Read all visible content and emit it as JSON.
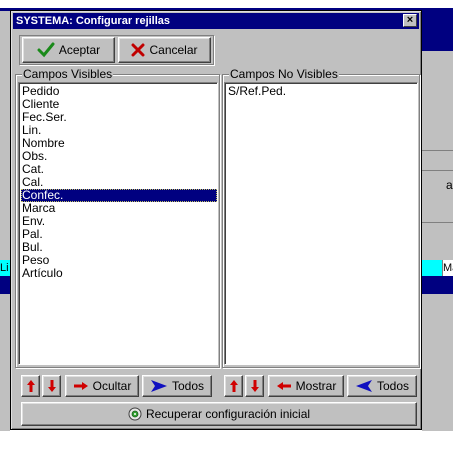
{
  "dialog": {
    "title": "SYSTEMA: Configurar rejillas",
    "close_glyph": "×",
    "accept_label": "Aceptar",
    "cancel_label": "Cancelar"
  },
  "visible_fields": {
    "title": "Campos Visibles",
    "items": [
      "Pedido",
      "Cliente",
      "Fec.Ser.",
      "Lin.",
      "Nombre",
      "Obs.",
      "Cat.",
      "Cal.",
      "Confec.",
      "Marca",
      "Env.",
      "Pal.",
      "Bul.",
      "Peso",
      "Artículo"
    ],
    "selected_index": 8
  },
  "hidden_fields": {
    "title": "Campos No Visibles",
    "items": [
      "S/Ref.Ped."
    ]
  },
  "left_controls": {
    "hide_label": "Ocultar",
    "all_label": "Todos"
  },
  "right_controls": {
    "show_label": "Mostrar",
    "all_label": "Todos"
  },
  "restore_label": "Recuperar configuración inicial",
  "background": {
    "cell_li": "Li",
    "cell_ma": "Ma",
    "cell_a": "a"
  },
  "colors": {
    "titlebar": "#000080",
    "selection": "#000080",
    "face": "#c0c0c0",
    "accept_check": "#1a8a1a",
    "cancel_x": "#c00000",
    "cyan_row": "#00ffff"
  }
}
